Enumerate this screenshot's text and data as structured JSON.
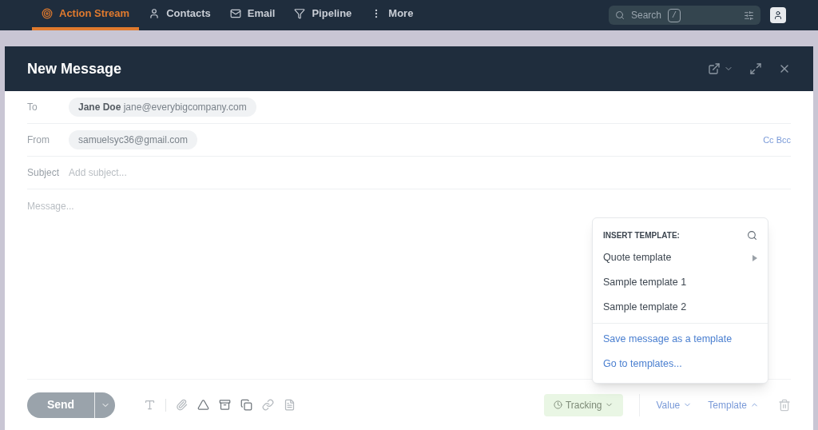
{
  "nav": {
    "tabs": [
      {
        "label": "Action Stream",
        "selected": true
      },
      {
        "label": "Contacts",
        "selected": false
      },
      {
        "label": "Email",
        "selected": false
      },
      {
        "label": "Pipeline",
        "selected": false
      },
      {
        "label": "More",
        "selected": false
      }
    ],
    "search": {
      "placeholder": "Search",
      "shortcut": "/"
    }
  },
  "window": {
    "title": "New Message"
  },
  "fields": {
    "to": {
      "label": "To",
      "name": "Jane Doe",
      "email": "jane@everybigcompany.com"
    },
    "from": {
      "label": "From",
      "email": "samuelsyc36@gmail.com",
      "cc_bcc": "Cc Bcc"
    },
    "subject": {
      "label": "Subject",
      "placeholder": "Add subject..."
    },
    "message": {
      "placeholder": "Message..."
    }
  },
  "footer": {
    "send": "Send",
    "tracking": "Tracking",
    "value": "Value",
    "template": {
      "label": "Template",
      "expanded": true
    }
  },
  "template_menu": {
    "heading": "INSERT TEMPLATE:",
    "templates": [
      {
        "label": "Quote template",
        "has_submenu": true
      },
      {
        "label": "Sample template 1",
        "has_submenu": false
      },
      {
        "label": "Sample template 2",
        "has_submenu": false
      }
    ],
    "actions": [
      "Save message as a template",
      "Go to templates..."
    ]
  }
}
